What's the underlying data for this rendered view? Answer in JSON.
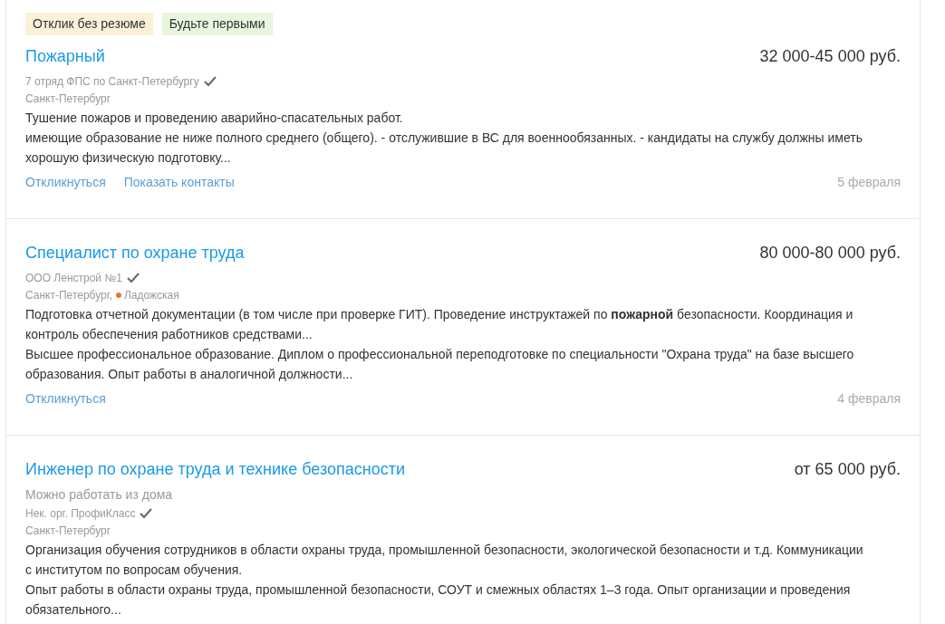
{
  "vacancies": [
    {
      "badges": [
        {
          "kind": "no_resume",
          "label": "Отклик без резюме"
        },
        {
          "kind": "first",
          "label": "Будьте первыми"
        }
      ],
      "title": "Пожарный",
      "salary": "32 000-45 000 руб.",
      "company": "7 отряд ФПС по Санкт-Петербургу",
      "company_verified": true,
      "city": "Санкт-Петербург",
      "responsibilities": "Тушение пожаров и проведению аварийно-спасательных работ.",
      "requirements": "имеющие образование не ниже полного среднего (общего). - отслужившие в ВС для военнообязанных. - кандидаты на службу должны иметь хорошую физическую подготовку...",
      "actions": [
        "Откликнуться",
        "Показать контакты"
      ],
      "date": "5 февраля"
    },
    {
      "title": "Специалист по охране труда",
      "salary": "80 000-80 000 руб.",
      "company": "ООО Ленстрой №1",
      "company_verified": true,
      "city": "Санкт-Петербург,",
      "metro": {
        "name": "Ладожская",
        "color": "#e8743b"
      },
      "responsibilities": "Подготовка отчетной документации (в том числе при проверке ГИТ). Проведение инструктажей по **пожарной** безопасности. Координация и контроль обеспечения работников средствами...",
      "requirements": "Высшее профессиональное образование. Диплом о профессиональной переподготовке по специальности \"Охрана труда\" на базе высшего образования. Опыт работы в аналогичной должности...",
      "actions": [
        "Откликнуться"
      ],
      "date": "4 февраля"
    },
    {
      "title": "Инженер по охране труда и технике безопасности",
      "salary": "от 65 000 руб.",
      "remote": "Можно работать из дома",
      "company": "Нек. орг. ПрофиКласс",
      "company_verified": true,
      "city": "Санкт-Петербург",
      "responsibilities": "Организация обучения сотрудников в области охраны труда, промышленной безопасности, экологической безопасности и т.д. Коммуникации с институтом по вопросам обучения.",
      "requirements": "Опыт работы в области охраны труда, промышленной безопасности, СОУТ и смежных областях 1–3 года. Опыт организации и проведения обязательного..."
    }
  ]
}
